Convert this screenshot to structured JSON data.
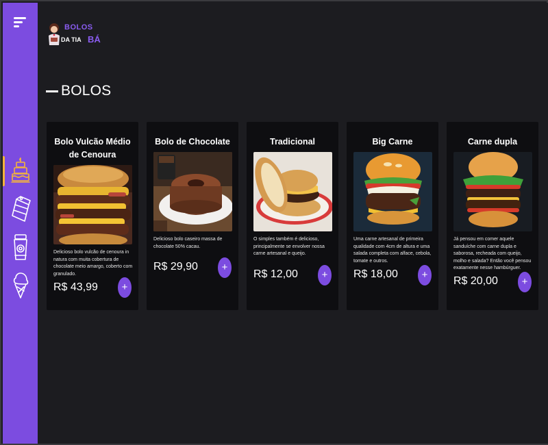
{
  "brand": {
    "line1": "BOLOS",
    "line2": "DA TIA",
    "line3": "BÁ"
  },
  "sidebar": {
    "menu_icon": "menu-icon",
    "items": [
      {
        "icon": "cake-icon",
        "active": true
      },
      {
        "icon": "cake-slice-icon",
        "active": false
      },
      {
        "icon": "cup-icon",
        "active": false
      },
      {
        "icon": "ice-cream-icon",
        "active": false
      }
    ]
  },
  "section": {
    "title": "BOLOS"
  },
  "products": [
    {
      "title": "Bolo Vulcão Médio de Cenoura",
      "description": "Delicioso bolo vulcão de cenoura in natura com muita cobertura de chocolate meio amargo, coberto com granulado.",
      "price": "R$ 43,99",
      "add_label": "+"
    },
    {
      "title": "Bolo de Chocolate",
      "description": "Delicioso bolo caseiro massa de chocolate 50% cacau.",
      "price": "R$ 29,90",
      "add_label": "+"
    },
    {
      "title": "Tradicional",
      "description": "O simples também é delicioso, principalmente se envolver nossa carne artesanal e queijo.",
      "price": "R$ 12,00",
      "add_label": "+"
    },
    {
      "title": "Big Carne",
      "description": "Uma carne artesanal de primeira qualidade com 4cm de altura e uma salada completa com alface, cebola, tomate e outros.",
      "price": "R$ 18,00",
      "add_label": "+"
    },
    {
      "title": "Carne dupla",
      "description": "Já pensou em comer aquele sanduíche com carne dupla e saborosa, recheada com queijo, molho e salada? Então você pensou exatamente nesse hambúrguer.",
      "price": "R$ 20,00",
      "add_label": "+"
    }
  ],
  "colors": {
    "accent": "#7c4ce0",
    "active_indicator": "#f3b33d",
    "background": "#1c1c20",
    "card": "#0e0e11"
  }
}
